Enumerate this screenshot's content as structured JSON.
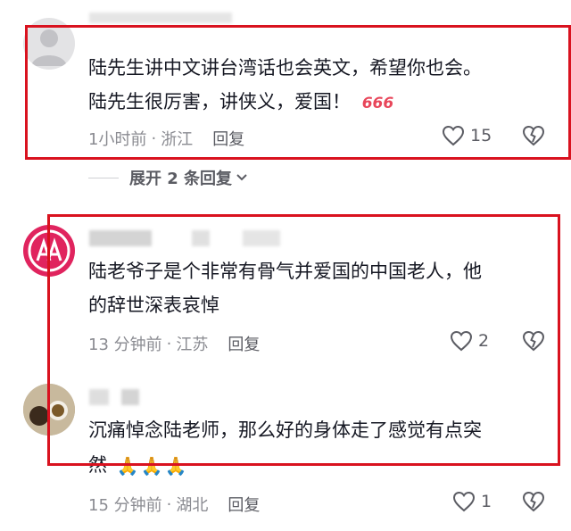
{
  "comments": [
    {
      "lines": [
        "陆先生讲中文讲台湾话也会英文，希望你也会。",
        "陆先生很厉害，讲侠义，爱国！"
      ],
      "badge": "666",
      "time": "1小时前",
      "location": "浙江",
      "reply": "回复",
      "likes": "15"
    },
    {
      "lines": [
        "陆老爷子是个非常有骨气并爱国的中国老人，他",
        "的辞世深表哀悼"
      ],
      "time": "13 分钟前",
      "location": "江苏",
      "reply": "回复",
      "likes": "2"
    },
    {
      "lines": [
        "沉痛悼念陆老师，那么好的身体走了感觉有点突",
        "然"
      ],
      "emojis": "🙏🙏🙏",
      "time": "15 分钟前",
      "location": "湖北",
      "reply": "回复",
      "likes": "1"
    }
  ],
  "expand": {
    "label": "展开 2 条回复"
  },
  "meta_separator": "·",
  "colors": {
    "highlight_box": "#d9121f",
    "meta_text": "#8a8b91",
    "badge": "#e8465a"
  },
  "icons": [
    "heart-icon",
    "broken-heart-icon",
    "chevron-down-icon"
  ]
}
